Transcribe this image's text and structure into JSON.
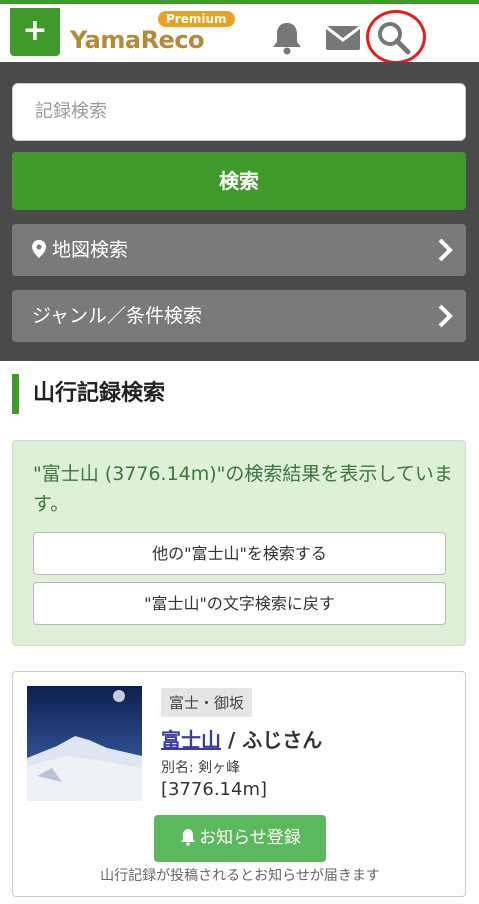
{
  "header": {
    "plus_label": "+",
    "logo_text": "YamaReco",
    "premium_badge": "Premium",
    "icons": [
      "bell-icon",
      "mail-icon",
      "search-icon"
    ]
  },
  "search": {
    "placeholder": "記録検索",
    "button_label": "検索",
    "map_search_label": "地図検索",
    "genre_search_label": "ジャンル／条件検索"
  },
  "section": {
    "title": "山行記録検索"
  },
  "notice": {
    "message": "\"富士山 (3776.14m)\"の検索結果を表示しています。",
    "other_search_label": "他の\"富士山\"を検索する",
    "back_label": "\"富士山\"の文字検索に戻す"
  },
  "mountain": {
    "area": "富士・御坂",
    "name": "富士山",
    "separator": " / ",
    "reading": "ふじさん",
    "alias": "別名: 剣ヶ峰",
    "elevation": "[3776.14m]",
    "notify_label": "お知らせ登録",
    "notify_note": "山行記録が投稿されるとお知らせが届きます"
  },
  "colors": {
    "brand_green": "#3f9a2b",
    "panel_dark": "#4a4a4a",
    "notice_bg": "#dff0d8",
    "highlight_red": "#e51e1e"
  }
}
